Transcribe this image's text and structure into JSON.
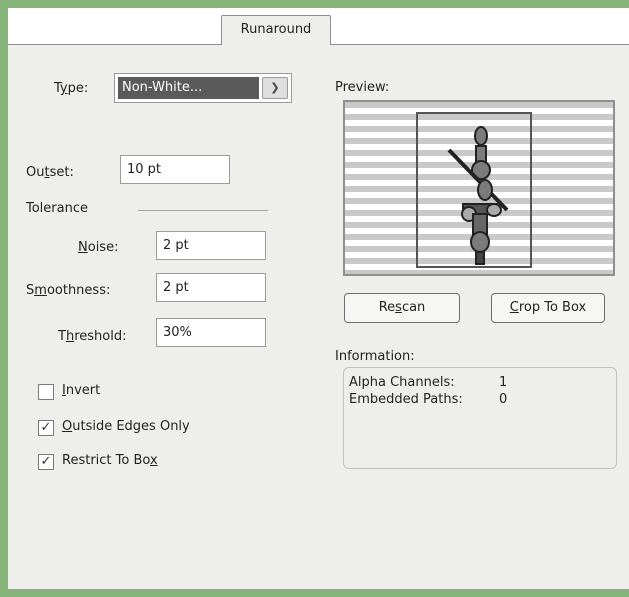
{
  "tab": {
    "label": "Runaround"
  },
  "type": {
    "label_prefix": "T",
    "label_u": "y",
    "label_suffix": "pe:",
    "value": "Non-White..."
  },
  "outset": {
    "label_prefix": "Ou",
    "label_u": "t",
    "label_suffix": "set:",
    "value": "10 pt"
  },
  "tolerance": {
    "heading": "Tolerance",
    "noise": {
      "label_prefix": "",
      "label_u": "N",
      "label_suffix": "oise:",
      "value": "2 pt"
    },
    "smoothness": {
      "label_prefix": "S",
      "label_u": "m",
      "label_suffix": "oothness:",
      "value": "2 pt"
    },
    "threshold": {
      "label_prefix": "T",
      "label_u": "h",
      "label_suffix": "reshold:",
      "value": "30%"
    }
  },
  "options": {
    "invert": {
      "label_u": "I",
      "label_suffix": "nvert",
      "checked": false
    },
    "outside_edges": {
      "label_u": "O",
      "label_suffix": "utside Edges Only",
      "checked": true
    },
    "restrict_box": {
      "label_prefix": "Restrict To Bo",
      "label_u": "x",
      "checked": true
    }
  },
  "preview": {
    "label": "Preview:"
  },
  "buttons": {
    "rescan": {
      "prefix": "Re",
      "u": "s",
      "suffix": "can"
    },
    "crop": {
      "u": "C",
      "suffix": "rop To Box"
    }
  },
  "information": {
    "label": "Information:",
    "rows": [
      {
        "name": "Alpha Channels:",
        "value": "1"
      },
      {
        "name": "Embedded Paths:",
        "value": "0"
      }
    ]
  },
  "colors": {
    "frame": "#86b47b",
    "panel": "#eeeeea",
    "selection": "#5a5a5a"
  }
}
